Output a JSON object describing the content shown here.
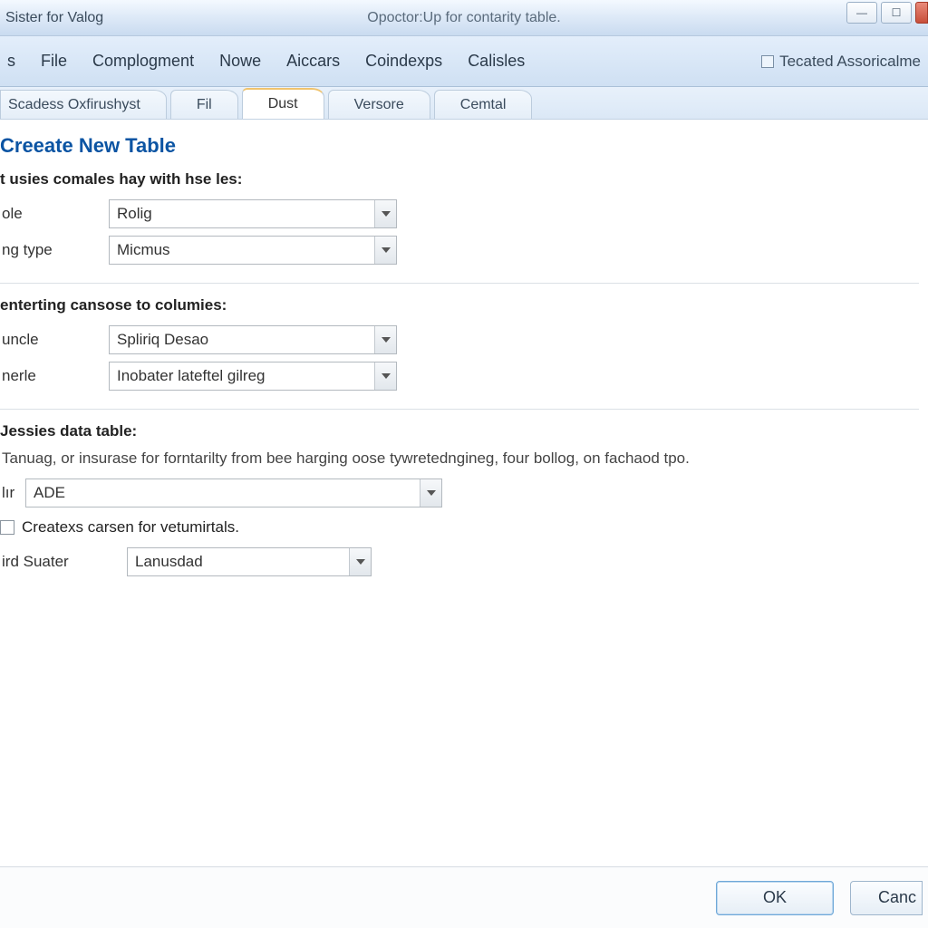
{
  "titlebar": {
    "left": "Sister for Valog",
    "center": "Opoctor:Up for contarity table."
  },
  "menu": {
    "items": [
      "s",
      "File",
      "Complogment",
      "Nowe",
      "Aiccars",
      "Coindexps",
      "Calisles"
    ],
    "right_label": "Tecated Assoricalme"
  },
  "tabs": [
    {
      "label": "Scadess Oxfirushyst",
      "active": false
    },
    {
      "label": "Fil",
      "active": false
    },
    {
      "label": "Dust",
      "active": true
    },
    {
      "label": "Versore",
      "active": false
    },
    {
      "label": "Cemtal",
      "active": false
    }
  ],
  "page": {
    "title": "Creeate New Table",
    "section1": {
      "heading": "t usies comales hay with hse les:",
      "rows": [
        {
          "label": "ole",
          "value": "Rolig"
        },
        {
          "label": "ng type",
          "value": "Micmus"
        }
      ]
    },
    "section2": {
      "heading": "enterting cansose to columies:",
      "rows": [
        {
          "label": "uncle",
          "value": "Spliriq Desao"
        },
        {
          "label": "nerle",
          "value": "Inobater lateftel gilreg"
        }
      ]
    },
    "section3": {
      "heading": "Jessies data table:",
      "help": "Tanuag, or insurase for forntarilty from bee harging oose tywretedngineg, four bollog, on fachaod tpo.",
      "combo1_label": "lır",
      "combo1_value": "ADE",
      "checkbox_label": "Createxs carsen for vetumirtals.",
      "row_label": "ird Suater",
      "row_value": "Lanusdad"
    }
  },
  "footer": {
    "ok": "OK",
    "cancel": "Canc"
  }
}
